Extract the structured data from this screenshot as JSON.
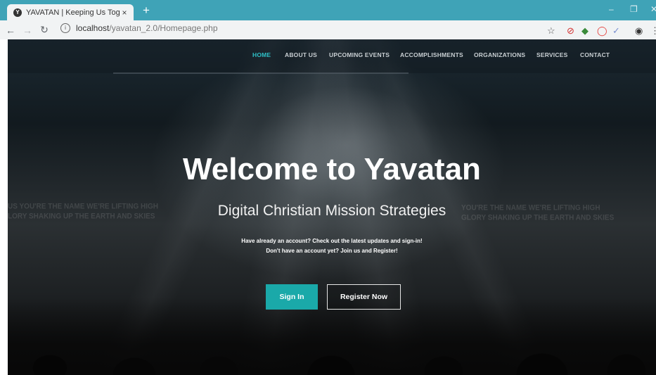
{
  "browser": {
    "tab_title": "YAVATAN | Keeping Us Together",
    "tab_close": "×",
    "new_tab": "+",
    "address_host": "localhost",
    "address_path": "/yavatan_2.0/Homepage.php"
  },
  "nav": {
    "items": [
      "HOME",
      "ABOUT US",
      "UPCOMING EVENTS",
      "ACCOMPLISHMENTS",
      "ORGANIZATIONS",
      "SERVICES",
      "CONTACT"
    ],
    "active_color": "#2ec0c7"
  },
  "hero": {
    "title": "Welcome to Yavatan",
    "subtitle": "Digital Christian Mission Strategies",
    "line1": "Have already an account? Check out the latest updates and sign-in!",
    "line2": "Don't have an account yet? Join us and Register!",
    "signin_label": "Sign In",
    "register_label": "Register Now",
    "signin_color": "#1aa9a9"
  },
  "background_text": {
    "left1": "US YOU'RE THE NAME WE'RE LIFTING HIGH",
    "left2": "LORY SHAKING UP THE EARTH AND SKIES",
    "right1": "YOU'RE THE NAME WE'RE LIFTING HIGH",
    "right2": "GLORY SHAKING UP THE EARTH AND SKIES"
  }
}
